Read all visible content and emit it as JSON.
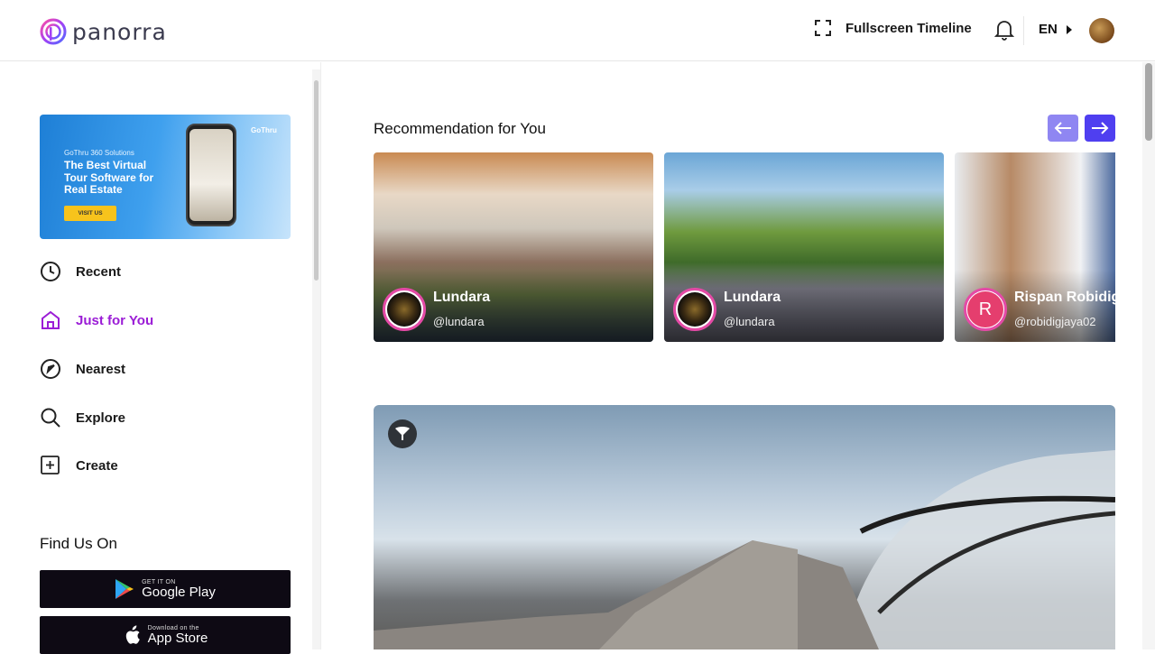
{
  "header": {
    "logo_text": "panorra",
    "fullscreen_label": "Fullscreen Timeline",
    "language": "EN"
  },
  "sidebar": {
    "ad": {
      "small": "GoThru 360 Solutions",
      "headline": "The Best Virtual Tour Software for Real Estate",
      "cta": "VISIT US",
      "brand": "GoThru"
    },
    "nav": [
      {
        "label": "Recent",
        "icon": "clock-icon"
      },
      {
        "label": "Just for You",
        "icon": "home-icon",
        "active": true
      },
      {
        "label": "Nearest",
        "icon": "navigation-arrow-icon"
      },
      {
        "label": "Explore",
        "icon": "search-icon"
      },
      {
        "label": "Create",
        "icon": "plus-square-icon"
      }
    ],
    "find_us_title": "Find Us On",
    "stores": [
      {
        "tiny": "GET IT ON",
        "name": "Google Play"
      },
      {
        "tiny": "Download on the",
        "name": "App Store"
      }
    ]
  },
  "main": {
    "recommendation_title": "Recommendation for You",
    "cards": [
      {
        "name": "Lundara",
        "handle": "@lundara",
        "avatar": "image"
      },
      {
        "name": "Lundara",
        "handle": "@lundara",
        "avatar": "image"
      },
      {
        "name": "Rispan Robidig",
        "handle": "@robidigjaya02",
        "avatar_letter": "R"
      }
    ]
  },
  "colors": {
    "accent_purple": "#9b1dd6",
    "arrow_prev": "#8f86f2",
    "arrow_next": "#4f3ff0"
  }
}
